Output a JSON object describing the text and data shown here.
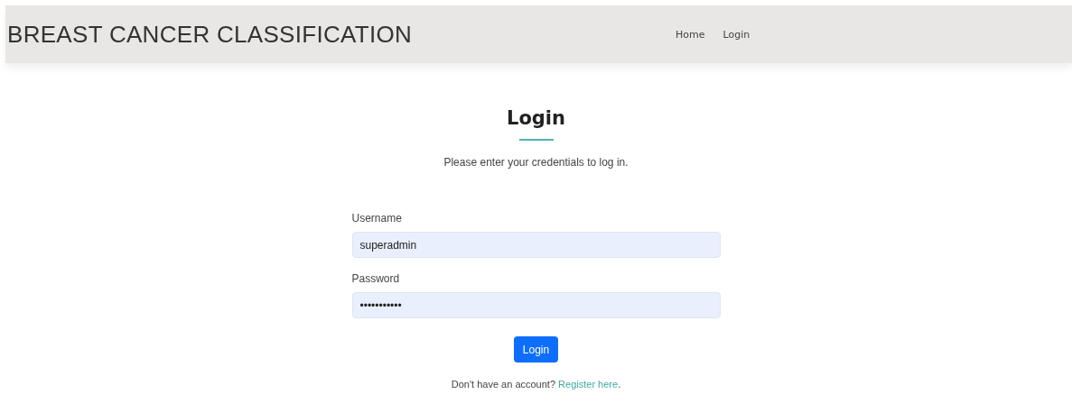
{
  "header": {
    "title": "BREAST CANCER CLASSIFICATION",
    "nav": [
      {
        "label": "Home"
      },
      {
        "label": "Login"
      }
    ]
  },
  "login": {
    "heading": "Login",
    "subtitle": "Please enter your credentials to log in.",
    "fields": [
      {
        "label": "Username",
        "value": "superadmin"
      },
      {
        "label": "Password",
        "value": "•••••••••••"
      }
    ],
    "button": "Login",
    "footer": {
      "text": "Don't have an account?",
      "link": "Register here",
      "end": "."
    }
  }
}
